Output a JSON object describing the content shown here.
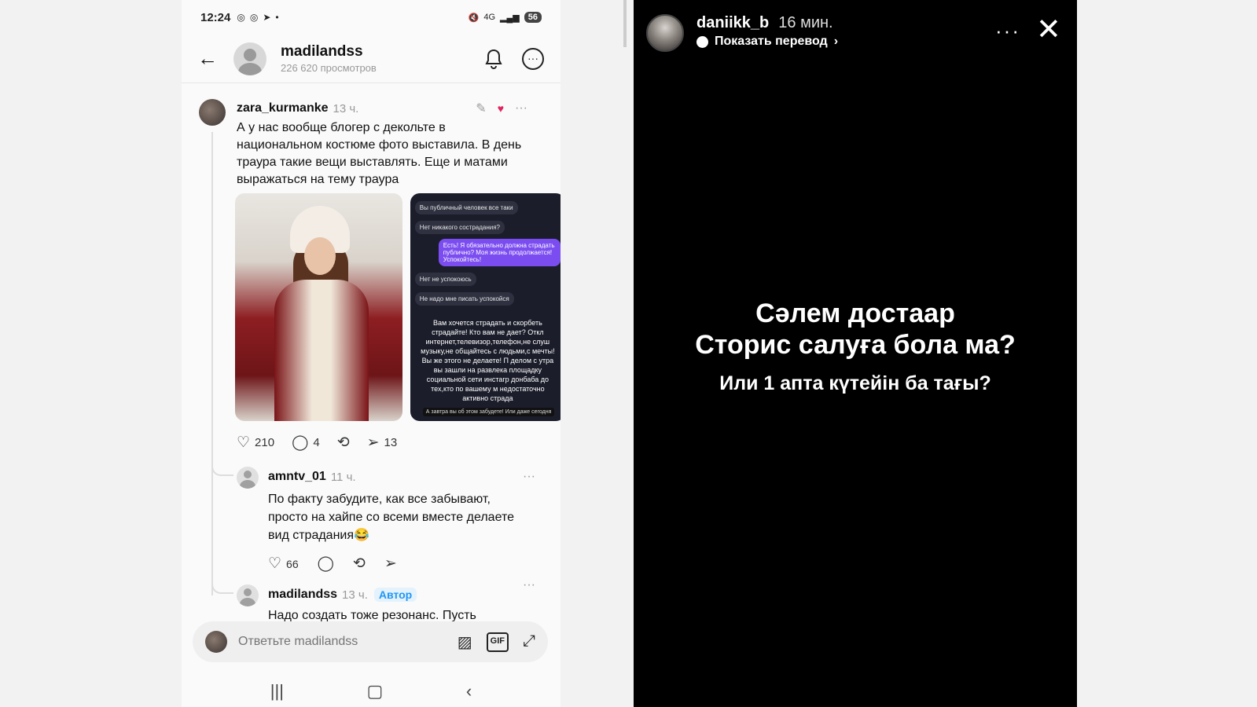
{
  "left_phone": {
    "status": {
      "time": "12:24",
      "network": "4G",
      "battery": "56"
    },
    "header": {
      "username": "madilandss",
      "views": "226 620 просмотров"
    },
    "post": {
      "username": "zara_kurmanke",
      "time": "13 ч.",
      "text": "А у нас вообще блогер с декольте  в национальном костюме фото выставила. В день траура такие вещи выставлять. Еще и матами выражаться на тему траура",
      "chat_bubbles": [
        "Вы публичный человек все таки",
        "Нет никакого сострадания?",
        "Есть! Я обязательно должна страдать публично? Моя жизнь продолжается! Успокойтесь!",
        "Нет не успокоюсь",
        "Не надо мне писать успокойся"
      ],
      "chat_text": "Вам хочется страдать и скорбеть страдайте! Кто вам не дает? Откл интернет,телевизор,телефон,не слуш музыку,не общайтесь с людьми,с мечты! Вы же этого не делаете! П делом с утра вы зашли на развлека площадку социальной сети инстагр донбаба до тех,кто по вашему м недостаточно активно страда",
      "chat_footer": "А завтра вы об этом забудете! Или даже сегодня",
      "likes": "210",
      "comments": "4",
      "shares": "13"
    },
    "reply1": {
      "username": "amntv_01",
      "time": "11 ч.",
      "text": "По факту забудите, как все забывают, просто на хайпе со всеми вместе делаете вид страдания😂",
      "likes": "66"
    },
    "reply2": {
      "username": "madilandss",
      "time": "13 ч.",
      "badge": "Автор",
      "text": "Надо создать тоже резонанс. Пусть"
    },
    "compose": {
      "placeholder": "Ответьте madilandss",
      "gif_label": "GIF"
    }
  },
  "story": {
    "username": "daniikk_b",
    "time": "16 мин.",
    "translate_label": "Показать перевод",
    "line1": "Сәлем достаар",
    "line2": "Сторис салуға бола ма?",
    "line3": "Или 1 апта күтейін ба тағы?"
  },
  "colors": {
    "story_bg": "#000000",
    "author_badge": "#2196f3",
    "like_heart": "#e0245e"
  }
}
